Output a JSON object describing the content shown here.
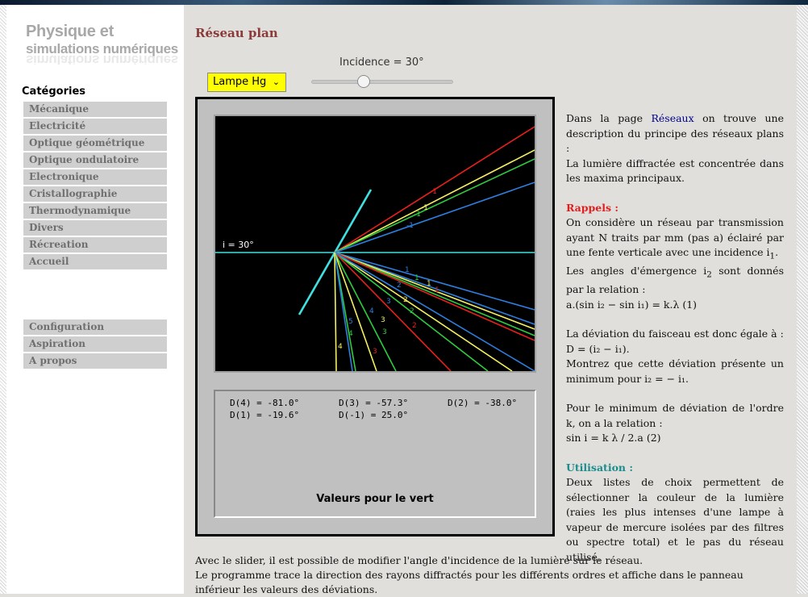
{
  "site": {
    "title_line1": "Physique et",
    "title_line2": "simulations numériques"
  },
  "sidebar": {
    "heading": "Catégories",
    "items": [
      "Mécanique",
      "Electricité",
      "Optique géométrique",
      "Optique ondulatoire",
      "Electronique",
      "Cristallographie",
      "Thermodynamique",
      "Divers",
      "Récreation",
      "Accueil"
    ],
    "items2": [
      "Configuration",
      "Aspiration",
      "A propos"
    ]
  },
  "page": {
    "title": "Réseau plan"
  },
  "controls": {
    "lamp_value": "Lampe Hg",
    "incidence_label": "Incidence = 30°",
    "incidence_deg": 30,
    "slider_min": 0,
    "slider_max": 90
  },
  "simulation": {
    "incidence_text": "i = 30°"
  },
  "panel": {
    "deviations": [
      "D(4) = -81.0°",
      "D(3) = -57.3°",
      "D(2) = -38.0°",
      "D(1) = -19.6°",
      "D(-1) = 25.0°"
    ],
    "label": "Valeurs pour le vert"
  },
  "colors": {
    "red": "#e8201c",
    "yellow": "#f4f060",
    "green": "#2ecc3e",
    "blue": "#2d7fe0",
    "cyan": "#40e0e0",
    "title": "#8b3a3a",
    "lamp_select": "#ffff00"
  },
  "content": {
    "intro_pre": "Dans la page ",
    "intro_link": "Réseaux",
    "intro_post": " on trouve une description du principe des réseaux plans :",
    "intro2": "La lumière diffractée est concentrée dans les maxima principaux.",
    "rappels_title": "Rappels :",
    "rappels1_pre": "On considère un réseau par transmission ayant N traits par mm (pas a) éclairé par une fente verticale avec une incidence i",
    "rappels1_sub": "1",
    "rappels1_post": ".",
    "rappels2_pre": "Les angles d'émergence i",
    "rappels2_sub": "2",
    "rappels2_post": " sont donnés par la relation :",
    "formula1": "a.(sin i₂ − sin i₁) = k.λ (1)",
    "deviation_line": "La déviation du faisceau est donc égale à :",
    "formula2": "D = (i₂ − i₁).",
    "montrez": "Montrez que cette déviation présente un minimum pour i₂ = − i₁.",
    "pour_min": "Pour le minimum de déviation de l'ordre k, on a la relation :",
    "formula3": "sin i = k λ / 2.a (2)",
    "utilisation_title": "Utilisation :",
    "utilisation_text": "Deux listes de choix permettent de sélectionner la couleur de la lumière (raies les plus intenses d'une lampe à vapeur de mercure isolées par des filtres ou spectre total) et le pas du réseau utilisé.",
    "bottom1": "Avec le slider, il est possible de modifier l'angle d'incidence de la lumière sur le réseau.",
    "bottom2": "Le programme trace la direction des rayons diffractés pour les différents ordres et affiche dans le panneau inférieur les valeurs des déviations."
  }
}
